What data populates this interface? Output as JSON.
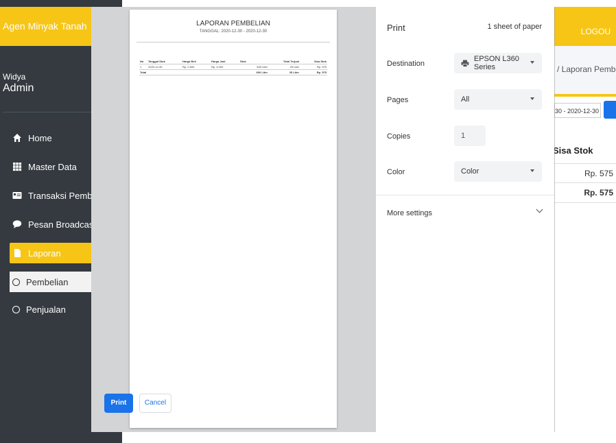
{
  "app": {
    "brand": "Agen Minyak Tanah",
    "logout": "LOGOU",
    "user": {
      "name": "Widya",
      "role": "Admin"
    },
    "nav": [
      {
        "label": "Home",
        "icon": "home-icon"
      },
      {
        "label": "Master Data",
        "icon": "grid-icon"
      },
      {
        "label": "Transaksi Pembelian",
        "icon": "id-card-icon"
      },
      {
        "label": "Pesan Broadcast",
        "icon": "comment-icon"
      },
      {
        "label": "Laporan",
        "icon": "file-icon",
        "active": true
      },
      {
        "label": "Pembelian",
        "icon": "circle-icon",
        "sub": true
      },
      {
        "label": "Penjualan",
        "icon": "circle-icon",
        "sub": true
      }
    ],
    "breadcrumb": "/ Laporan Pembeli",
    "date_range": "30 - 2020-12-30",
    "table": {
      "header": "Sisa Stok",
      "rows": [
        "Rp. 575",
        "Rp. 575"
      ]
    }
  },
  "preview": {
    "title": "LAPORAN PEMBELIAN",
    "subtitle": "TANGGAL: 2020-12-30 - 2020-12-30",
    "columns": [
      "No",
      "Tanggal Stok",
      "Harga Beli",
      "Harga Jual",
      "Stok",
      "Total Terjual",
      "Sisa Stok"
    ],
    "rows": [
      [
        "1",
        "2020-12-30",
        "Rp. 2.500",
        "Rp. 4.000",
        "600 Liter",
        "25 Liter",
        "Rp. 575"
      ]
    ],
    "total_row": [
      "Total",
      "",
      "",
      "",
      "600 Liter",
      "25 Liter",
      "Rp. 575"
    ]
  },
  "print_dialog": {
    "title": "Print",
    "sheets": "1 sheet of paper",
    "destination": {
      "label": "Destination",
      "value": "EPSON L360 Series"
    },
    "pages": {
      "label": "Pages",
      "value": "All"
    },
    "copies": {
      "label": "Copies",
      "value": "1"
    },
    "color": {
      "label": "Color",
      "value": "Color"
    },
    "more_settings": "More settings",
    "print_button": "Print",
    "cancel_button": "Cancel"
  },
  "colors": {
    "brand_yellow": "#f6c516",
    "sidebar_dark": "#343a40",
    "accent_blue": "#1a73e8"
  }
}
